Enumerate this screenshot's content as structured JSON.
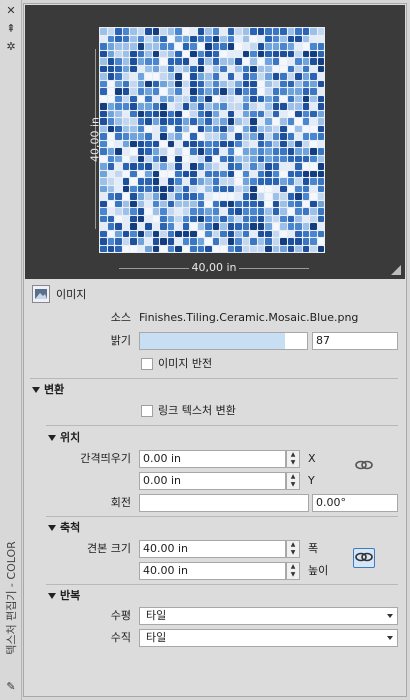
{
  "sidebar": {
    "title": "텍스처 편집기 - COLOR"
  },
  "preview": {
    "width_label": "40,00 in",
    "height_label": "40,00 in"
  },
  "image_section": {
    "label": "이미지",
    "source_label": "소스",
    "source_value": "Finishes.Tiling.Ceramic.Mosaic.Blue.png",
    "brightness_label": "밝기",
    "brightness_value": "87",
    "brightness_fraction": 0.87,
    "invert_label": "이미지 반전",
    "invert_checked": false
  },
  "transform_section": {
    "title": "변환",
    "link_label": "링크 텍스처 변환",
    "link_checked": false
  },
  "position_section": {
    "title": "위치",
    "offset_label": "간격띄우기",
    "offset_x": "0.00 in",
    "offset_y": "0.00 in",
    "x_label": "X",
    "y_label": "Y",
    "rotation_label": "회전",
    "rotation_value": "0.00°"
  },
  "scale_section": {
    "title": "축척",
    "sample_size_label": "견본 크기",
    "width_value": "40.00 in",
    "height_value": "40.00 in",
    "width_label": "폭",
    "height_label": "높이"
  },
  "repeat_section": {
    "title": "반복",
    "horizontal_label": "수평",
    "horizontal_value": "타일",
    "vertical_label": "수직",
    "vertical_value": "타일"
  },
  "colors": {
    "tile_palette": [
      "#1d4f9c",
      "#2c64b4",
      "#4a86cf",
      "#6fa3dc",
      "#9cc0e8",
      "#c3d8f0",
      "#e3ecf7",
      "#f4f7fb",
      "#143d80",
      "#3a76c2"
    ]
  }
}
